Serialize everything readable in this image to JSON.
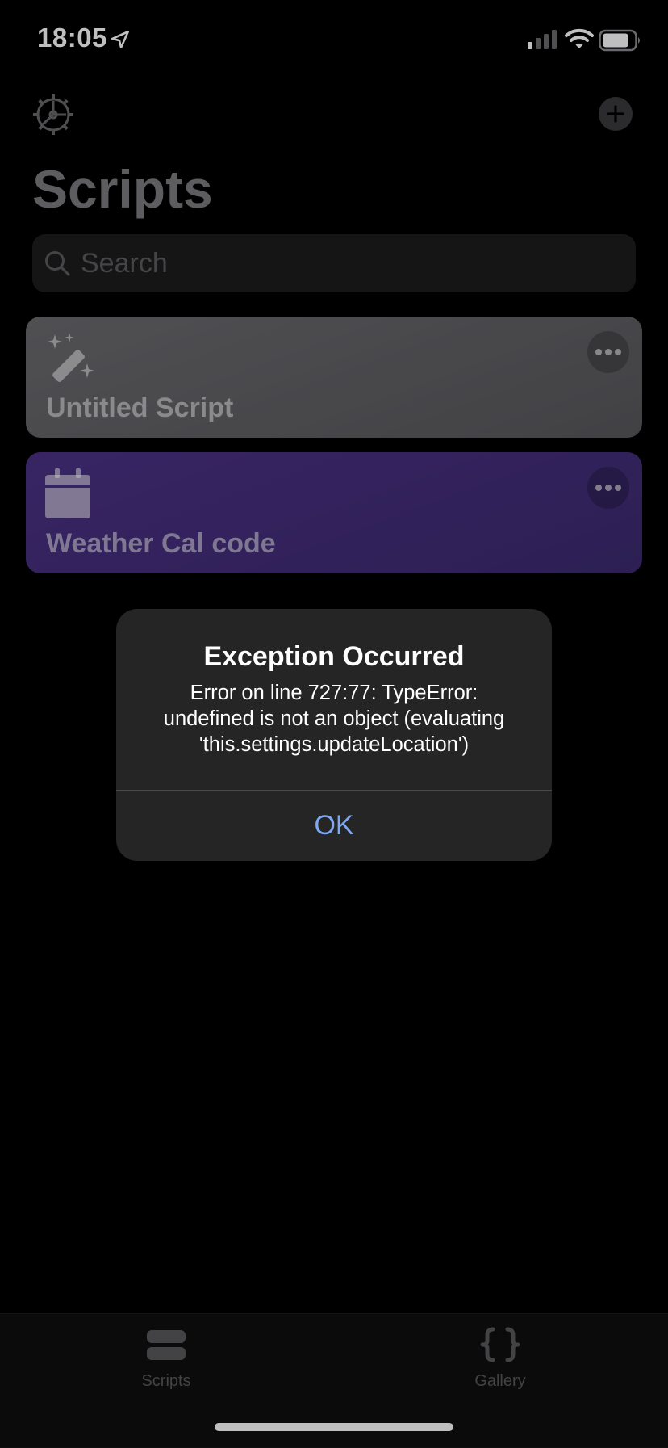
{
  "status_bar": {
    "time": "18:05",
    "icons": [
      "location-arrow-icon",
      "cellular-signal-icon",
      "wifi-icon",
      "battery-icon"
    ]
  },
  "nav": {
    "settings_icon": "gear-icon",
    "add_icon": "plus-icon",
    "title": "Scripts"
  },
  "search": {
    "placeholder": "Search"
  },
  "scripts": [
    {
      "title": "Untitled Script",
      "icon": "magic-wand-icon",
      "color": "#636366",
      "more_icon": "ellipsis-icon"
    },
    {
      "title": "Weather Cal code",
      "icon": "calendar-icon",
      "color": "#46307e",
      "more_icon": "ellipsis-icon"
    }
  ],
  "alert": {
    "title": "Exception Occurred",
    "message": "Error on line 727:77: TypeError:\nundefined is not an object (evaluating\n'this.settings.updateLocation')",
    "button": "OK"
  },
  "tab_bar": {
    "tabs": [
      {
        "label": "Scripts",
        "icon": "stack-icon",
        "selected": true
      },
      {
        "label": "Gallery",
        "icon": "braces-icon",
        "selected": false
      }
    ]
  },
  "colors": {
    "background": "#000000",
    "accent": "#7ea9f2",
    "alert_background": "#252526"
  }
}
